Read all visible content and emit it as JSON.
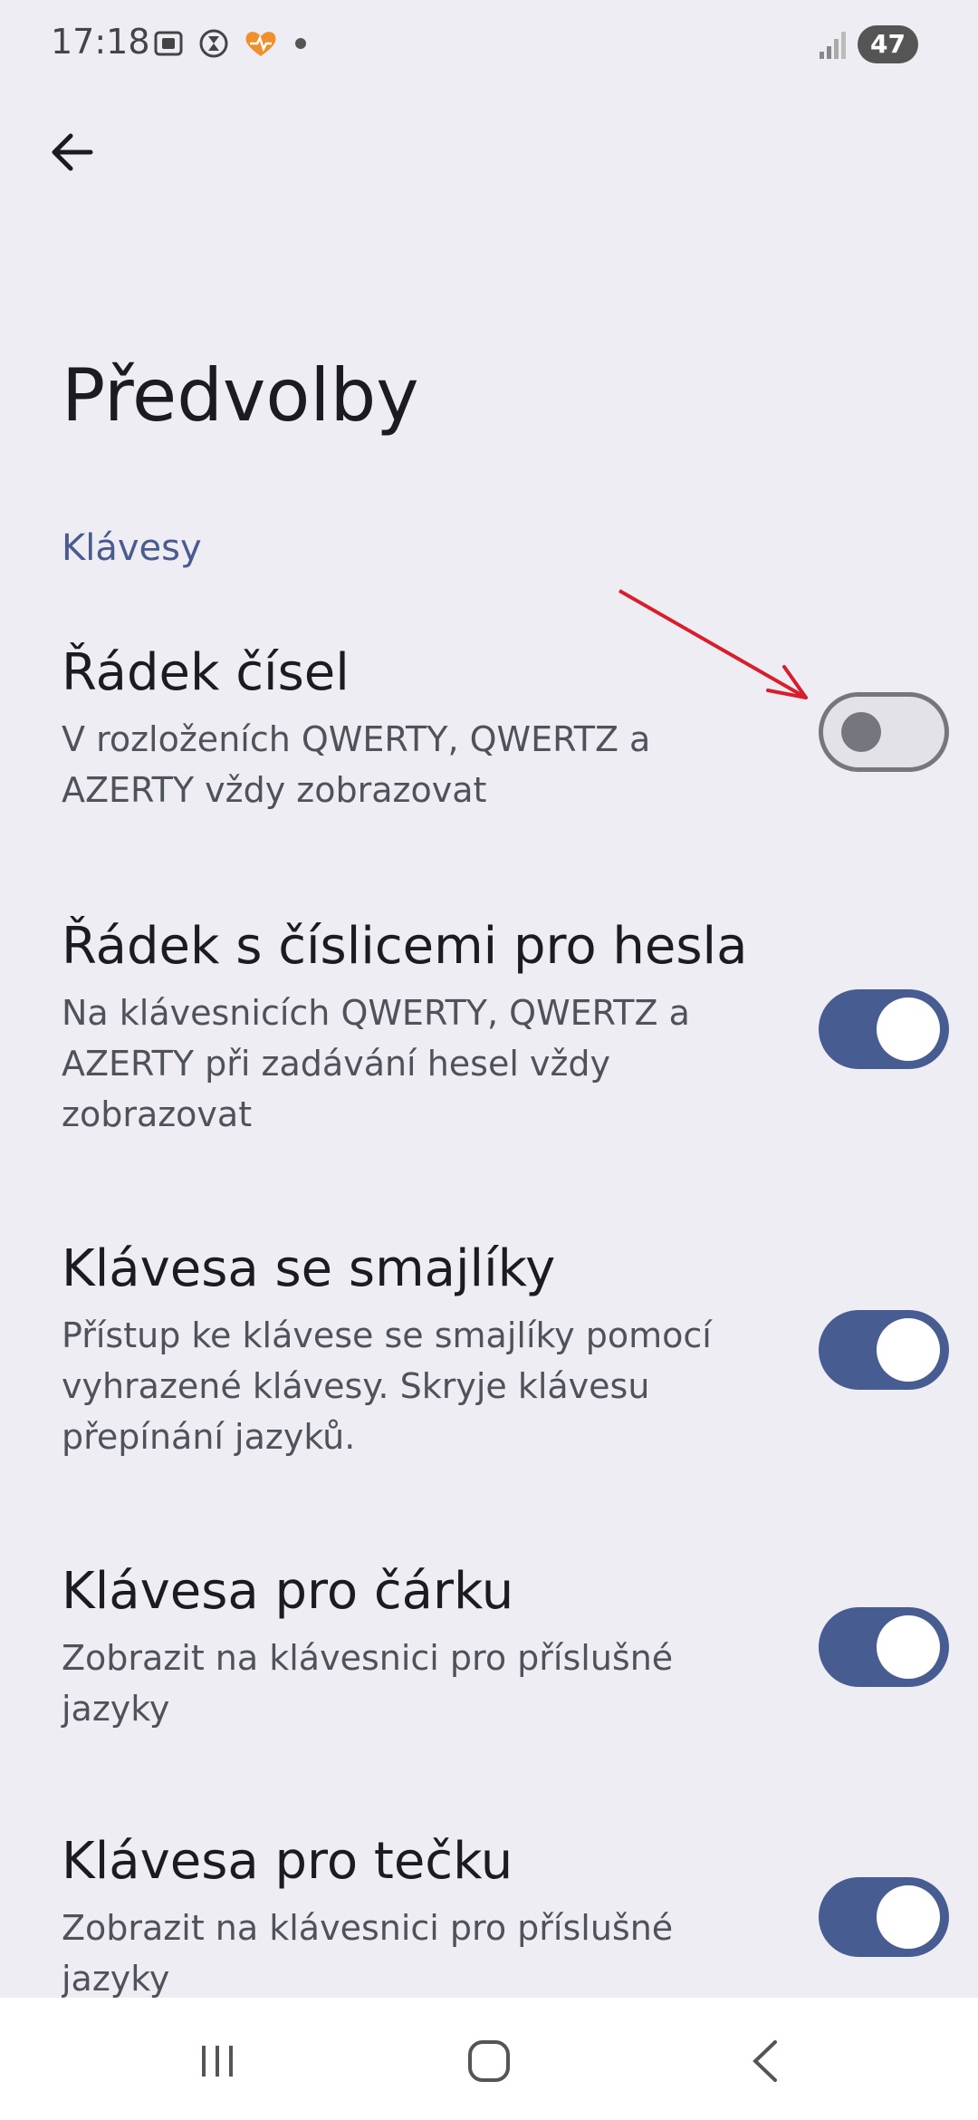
{
  "status_bar": {
    "time": "17:18",
    "battery": "47",
    "icons": [
      "screenshot-icon",
      "timer-icon",
      "app-heart-icon",
      "dot-icon",
      "signal-icon"
    ]
  },
  "header": {
    "title": "Předvolby"
  },
  "section": {
    "label": "Klávesy"
  },
  "settings": [
    {
      "title": "Řádek čísel",
      "description": "V rozloženích QWERTY, QWERTZ a AZERTY vždy zobrazovat",
      "enabled": false
    },
    {
      "title": "Řádek s číslicemi pro hesla",
      "description": "Na klávesnicích QWERTY, QWERTZ a AZERTY při zadávání hesel vždy zobrazovat",
      "enabled": true
    },
    {
      "title": "Klávesa se smajlíky",
      "description": "Přístup ke klávese se smajlíky pomocí vyhrazené klávesy. Skryje klávesu přepínání jazyků.",
      "enabled": true
    },
    {
      "title": "Klávesa pro čárku",
      "description": "Zobrazit na klávesnici pro příslušné jazyky",
      "enabled": true
    },
    {
      "title": "Klávesa pro tečku",
      "description": "Zobrazit na klávesnici pro příslušné jazyky",
      "enabled": true
    }
  ],
  "colors": {
    "background": "#eeedf4",
    "accent": "#475c90",
    "section_header": "#4a5b8f",
    "annotation_arrow": "#d81e2c"
  }
}
